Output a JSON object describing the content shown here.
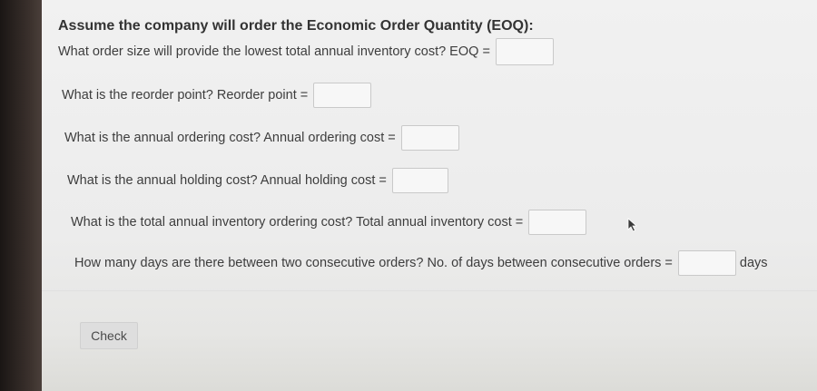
{
  "section": {
    "heading": "Assume the company will order the Economic Order Quantity (EOQ):"
  },
  "questions": [
    {
      "text": "What order size will provide the lowest total annual inventory cost? EOQ =",
      "value": "",
      "unit": ""
    },
    {
      "text": "What is the reorder point? Reorder point =",
      "value": "",
      "unit": ""
    },
    {
      "text": "What is the annual ordering cost? Annual ordering cost =",
      "value": "",
      "unit": ""
    },
    {
      "text": "What is the annual holding cost? Annual holding cost =",
      "value": "",
      "unit": ""
    },
    {
      "text": "What is the total annual inventory ordering cost? Total annual inventory cost =",
      "value": "",
      "unit": ""
    },
    {
      "text": "How many days are there between two consecutive orders? No. of days between consecutive orders =",
      "value": "",
      "unit": "days"
    }
  ],
  "actions": {
    "check_label": "Check"
  },
  "icons": {
    "cursor": "mouse-pointer-icon"
  }
}
